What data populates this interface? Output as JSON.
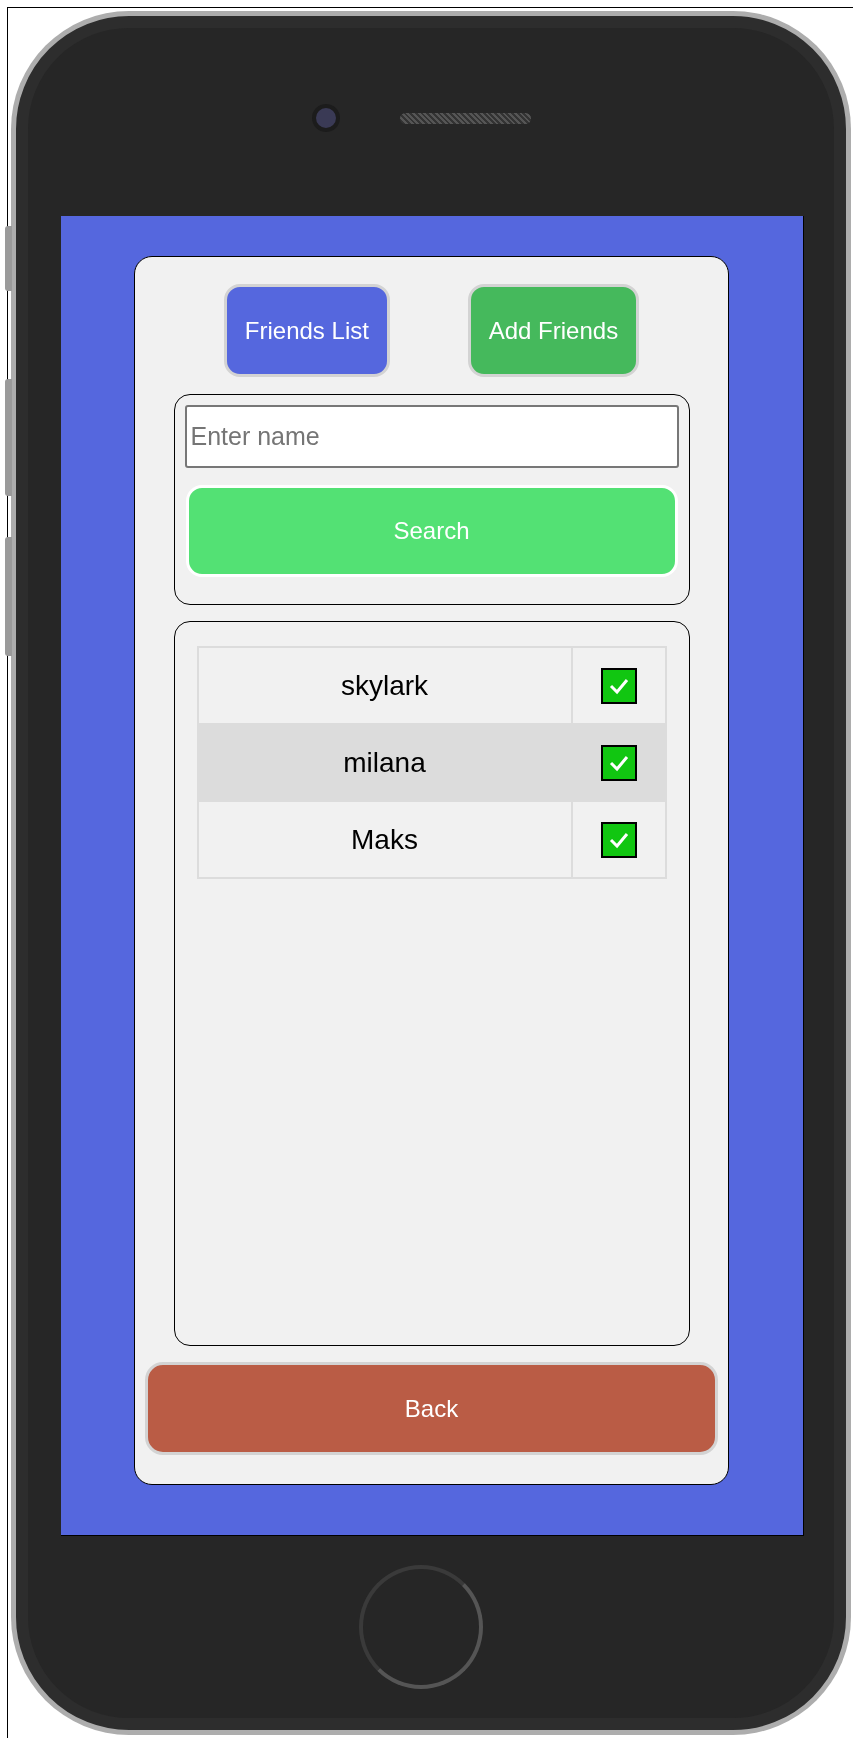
{
  "tabs": [
    {
      "label": "Friends List",
      "color": "#5567de"
    },
    {
      "label": "Add Friends",
      "color": "#45b95c"
    }
  ],
  "search": {
    "placeholder": "Enter name",
    "button": "Search"
  },
  "friends": [
    {
      "name": "skylark",
      "checked": true,
      "selected": false
    },
    {
      "name": "milana",
      "checked": true,
      "selected": true
    },
    {
      "name": "Maks",
      "checked": true,
      "selected": false
    }
  ],
  "back_button": "Back"
}
